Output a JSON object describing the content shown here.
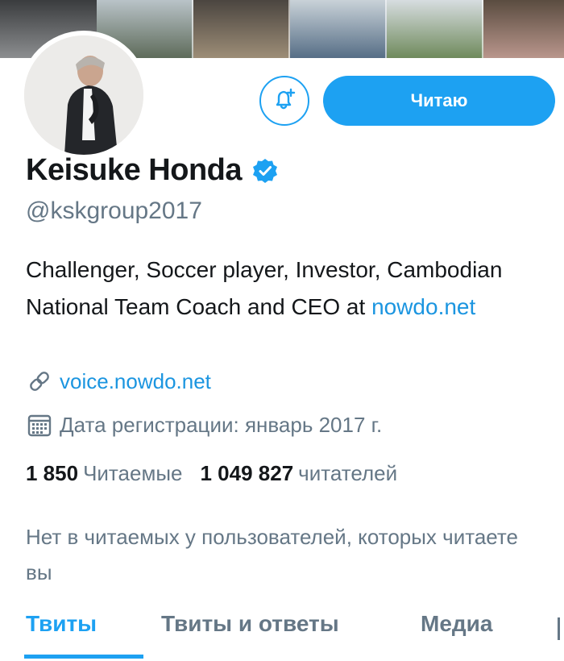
{
  "profile": {
    "display_name": "Keisuke Honda",
    "handle": "@kskgroup2017",
    "bio_text": "Challenger, Soccer player, Investor, Cambodian National Team Coach and CEO at ",
    "bio_link": "nowdo.net",
    "website": "voice.nowdo.net",
    "joined": "Дата регистрации: январь 2017 г."
  },
  "actions": {
    "follow_label": "Читаю"
  },
  "stats": {
    "following_count": "1 850",
    "following_label": "Читаемые",
    "followers_count": "1 049 827",
    "followers_label": "читателей"
  },
  "known_followers": "Нет в читаемых у пользователей, которых читаете вы",
  "tabs": [
    {
      "label": "Твиты"
    },
    {
      "label": "Твиты и ответы"
    },
    {
      "label": "Медиа"
    }
  ],
  "colors": {
    "accent": "#1da1f2",
    "link": "#1b95e0",
    "secondary_text": "#657786",
    "primary_text": "#14171a"
  },
  "icons": {
    "bell": "bell-plus-icon",
    "verified": "verified-badge-icon",
    "link": "link-icon",
    "calendar": "calendar-icon"
  }
}
